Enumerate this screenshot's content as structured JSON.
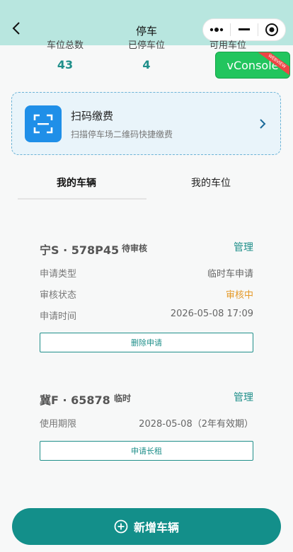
{
  "nav": {
    "title": "停车"
  },
  "stats": [
    {
      "label": "车位总数",
      "value": "43"
    },
    {
      "label": "已停车位",
      "value": "4"
    },
    {
      "label": "可用车位",
      "value": ""
    }
  ],
  "vconsole": {
    "label": "vConsole",
    "ribbon": "WEBVIEW"
  },
  "scan": {
    "title": "扫码缴费",
    "subtitle": "扫描停车场二维码快捷缴费"
  },
  "tabs": {
    "my_vehicles": "我的车辆",
    "my_spaces": "我的车位"
  },
  "vehicle1": {
    "plate": "宁S · 578P45",
    "badge": "待审核",
    "manage": "管理",
    "rows": [
      {
        "label": "申请类型",
        "value": "临时车申请"
      },
      {
        "label": "审核状态",
        "value": "审核中"
      },
      {
        "label": "申请时间",
        "value": "2026-05-08 17:09"
      }
    ],
    "action": "删除申请"
  },
  "vehicle2": {
    "plate": "冀F · 65878",
    "badge": "临时",
    "manage": "管理",
    "rows": [
      {
        "label": "使用期限",
        "value": "2028-05-08（2年有效期）"
      }
    ],
    "action": "申请长租"
  },
  "add_button": {
    "label": "新增车辆"
  },
  "colors": {
    "accent": "#1f8f8a",
    "pending": "#e59a2a",
    "scan_icon": "#1f8fe8",
    "nav_bg": "#b8e6df"
  }
}
